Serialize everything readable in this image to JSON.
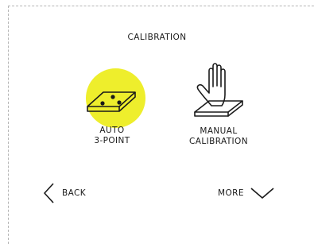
{
  "screen": {
    "title": "CALIBRATION"
  },
  "options": [
    {
      "label_line1": "AUTO",
      "label_line2": "3-POINT",
      "icon": "bed-probe-icon",
      "selected": true
    },
    {
      "label_line1": "MANUAL",
      "label_line2": "CALIBRATION",
      "icon": "hand-on-bed-icon",
      "selected": false
    }
  ],
  "nav": {
    "back_label": "BACK",
    "more_label": "MORE"
  },
  "colors": {
    "highlight": "#eeee2c",
    "text": "#1a1a1a",
    "border": "#b5b5b5"
  }
}
